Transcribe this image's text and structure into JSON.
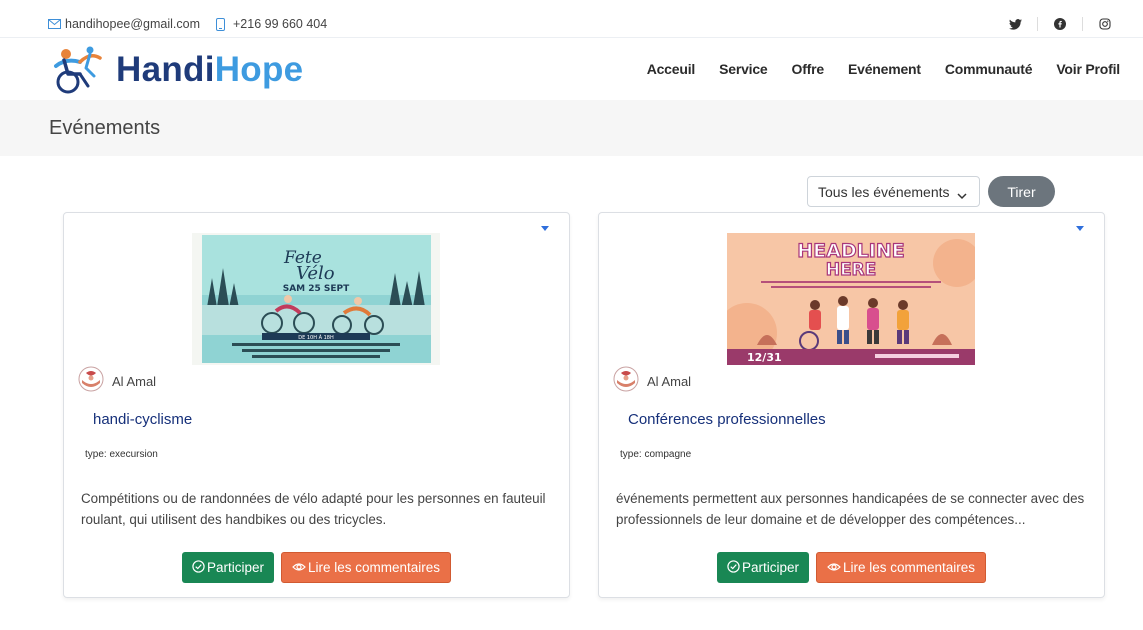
{
  "topbar": {
    "email": "handihopee@gmail.com",
    "phone": "+216 99 660 404",
    "social": [
      "twitter-icon",
      "facebook-icon",
      "instagram-icon"
    ]
  },
  "brand": {
    "name_part1": "Handi",
    "name_part2": "Hope",
    "color_dark": "#1f3b7a",
    "color_light": "#3e9be0"
  },
  "nav": {
    "items": [
      "Acceuil",
      "Service",
      "Offre",
      "Evénement",
      "Communauté",
      "Voir Profil"
    ]
  },
  "page": {
    "title": "Evénements"
  },
  "filter": {
    "selected": "Tous les événements",
    "button": "Tirer"
  },
  "events": [
    {
      "org": "Al Amal",
      "title": "handi-cyclisme",
      "type": "type: execursion",
      "description": "Compétitions ou de randonnées de vélo adapté pour les personnes en fauteuil roulant, qui utilisent des handbikes ou des tricycles.",
      "participate": "Participer",
      "comments": "Lire les commentaires",
      "poster": {
        "headline1": "Fete",
        "headline2": "Vélo",
        "date": "SAM 25 SEPT",
        "banner": "DE 10H À 18H"
      }
    },
    {
      "org": "Al Amal",
      "title": "Conférences professionnelles",
      "type": "type: compagne",
      "description": "événements permettent aux personnes handicapées de se connecter avec des professionnels de leur domaine et de développer des compétences...",
      "participate": "Participer",
      "comments": "Lire les commentaires",
      "poster": {
        "headline1": "HEADLINE",
        "headline2": "HERE",
        "date": "12/31"
      }
    }
  ],
  "colors": {
    "participate": "#198754",
    "comments": "#ea7047",
    "tirer": "#6c757d"
  }
}
